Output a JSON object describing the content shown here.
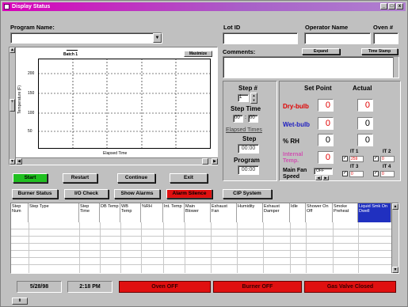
{
  "window": {
    "title": "Display Status",
    "min": "_",
    "max": "□",
    "close": "x"
  },
  "top": {
    "program_label": "Program Name:",
    "lot_label": "Lot ID",
    "operator_label": "Operator Name",
    "oven_label": "Oven #"
  },
  "chart": {
    "legend": "Batch 1",
    "maximize_label": "Maximize",
    "ylabel": "Temperature (F)",
    "xlabel": "Elapsed Time",
    "y_ticks": [
      "200",
      "150",
      "100",
      "50"
    ],
    "zoom_label": "+"
  },
  "comments": {
    "label": "Comments:",
    "expand": "Expand",
    "timestamp": "Time Stamp"
  },
  "step": {
    "step_label": "Step #",
    "step_value": "1",
    "step_time_label": "Step Time",
    "hh": "00",
    "mm": "00",
    "elapsed_label": "Elapsed Times",
    "elapsed_step_label": "Step",
    "elapsed_step_value": "00:00",
    "program_label": "Program",
    "program_value": "00:00"
  },
  "setpoints": {
    "setpoint_header": "Set Point",
    "actual_header": "Actual",
    "rows": [
      {
        "label": "Dry-bulb",
        "set": "0",
        "actual": "0"
      },
      {
        "label": "Wet-bulb",
        "set": "0",
        "actual": "0"
      },
      {
        "label": "% RH",
        "set": "0",
        "actual": "0"
      },
      {
        "label": "Internal Temp.",
        "set": "0"
      }
    ],
    "main_fan_label": "Main Fan Speed",
    "main_fan_value": "OFF",
    "it": [
      {
        "label": "IT 1",
        "value": "259"
      },
      {
        "label": "IT 2",
        "value": "0"
      },
      {
        "label": "IT 3",
        "value": "0"
      },
      {
        "label": "IT 4",
        "value": "0"
      }
    ]
  },
  "controls": {
    "start": "Start",
    "restart": "Restart",
    "continue": "Continue",
    "exit": "Exit",
    "burner_status": "Burner Status",
    "io_check": "I/O Check",
    "show_alarms": "Show Alarms",
    "alarm_silence": "Alarm Silence",
    "cip_system": "CIP System"
  },
  "grid": {
    "headers": [
      "Step Num",
      "Step Type",
      "Step Time",
      "DB Temp",
      "WB Temp",
      "%RH",
      "Int. Temp",
      "Main Blower",
      "Exhaust Fan",
      "Humidity",
      "Exhaust Damper",
      "Idle",
      "Shower On    Off",
      "Smoke Preheat",
      "Liquid Smk On  Dwell"
    ]
  },
  "status": {
    "date": "5/28/98",
    "time": "2:18 PM",
    "oven": "Oven OFF",
    "burner": "Burner OFF",
    "gas": "Gas Valve Closed"
  },
  "colors": {
    "accent_red": "#e01010",
    "title_magenta": "#d800b8",
    "start_green": "#20c020"
  }
}
